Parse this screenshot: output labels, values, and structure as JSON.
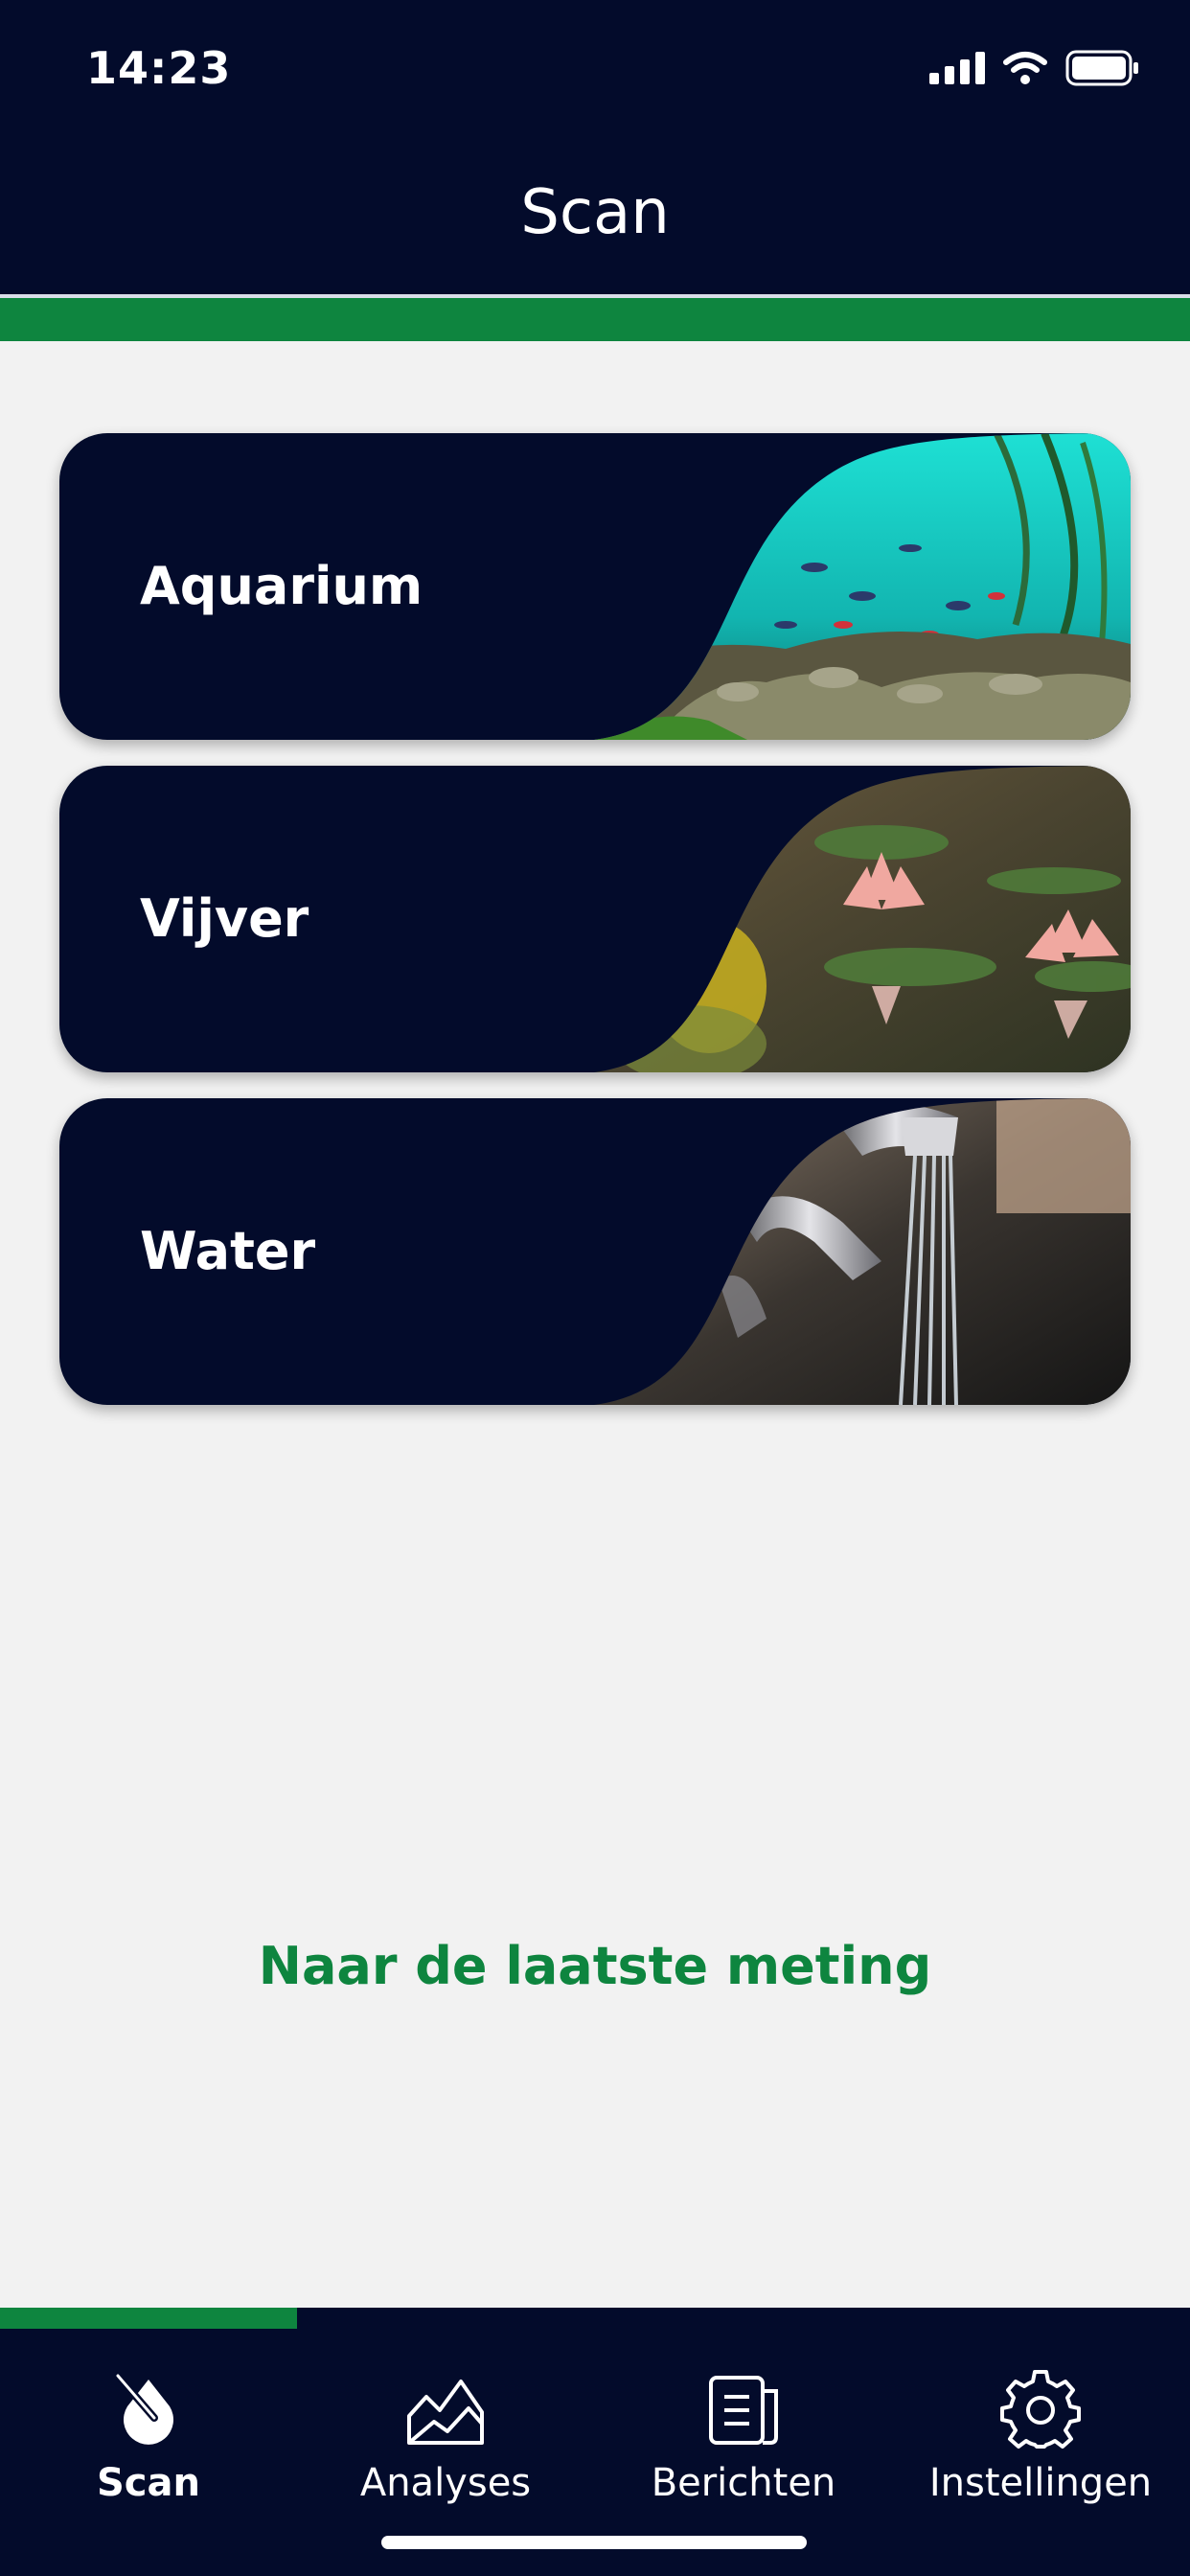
{
  "status_bar": {
    "time": "14:23",
    "icons": [
      "signal-icon",
      "wifi-icon",
      "battery-icon"
    ]
  },
  "header": {
    "title": "Scan"
  },
  "cards": [
    {
      "label": "Aquarium",
      "image": "aquarium-image"
    },
    {
      "label": "Vijver",
      "image": "pond-image"
    },
    {
      "label": "Water",
      "image": "water-tap-image"
    }
  ],
  "last_measurement_link": "Naar de laatste meting",
  "tabs": [
    {
      "label": "Scan",
      "icon": "scan-icon",
      "active": true
    },
    {
      "label": "Analyses",
      "icon": "analyses-icon",
      "active": false
    },
    {
      "label": "Berichten",
      "icon": "messages-icon",
      "active": false
    },
    {
      "label": "Instellingen",
      "icon": "settings-icon",
      "active": false
    }
  ],
  "colors": {
    "navy": "#030b2b",
    "green": "#0e853f",
    "background": "#f2f2f2"
  }
}
